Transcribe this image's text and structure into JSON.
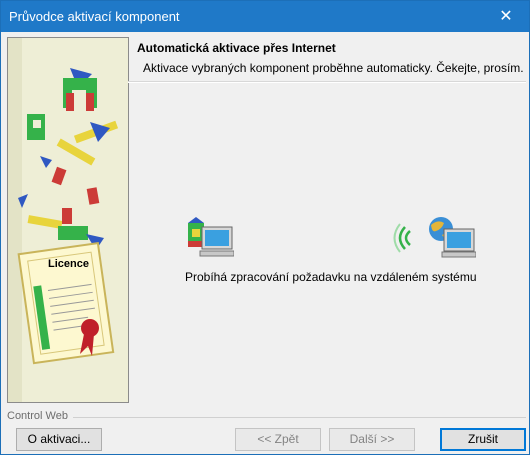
{
  "window": {
    "title": "Průvodce aktivací komponent",
    "close_glyph": "✕"
  },
  "side_panel": {
    "license_text": "Licence"
  },
  "header": {
    "title": "Automatická aktivace přes Internet",
    "subtitle": "Aktivace vybraných komponent proběhne automaticky. Čekejte, prosím."
  },
  "content": {
    "status": "Probíhá zpracování požadavku na vzdáleném systému",
    "left_icon": "local-computer-icon",
    "right_icon": "remote-server-icon",
    "waves_icon": "signal-waves-icon"
  },
  "footer": {
    "brand": "Control Web",
    "buttons": {
      "about": "O aktivaci...",
      "back": "<< Zpět",
      "next": "Další >>",
      "cancel": "Zrušit"
    }
  }
}
